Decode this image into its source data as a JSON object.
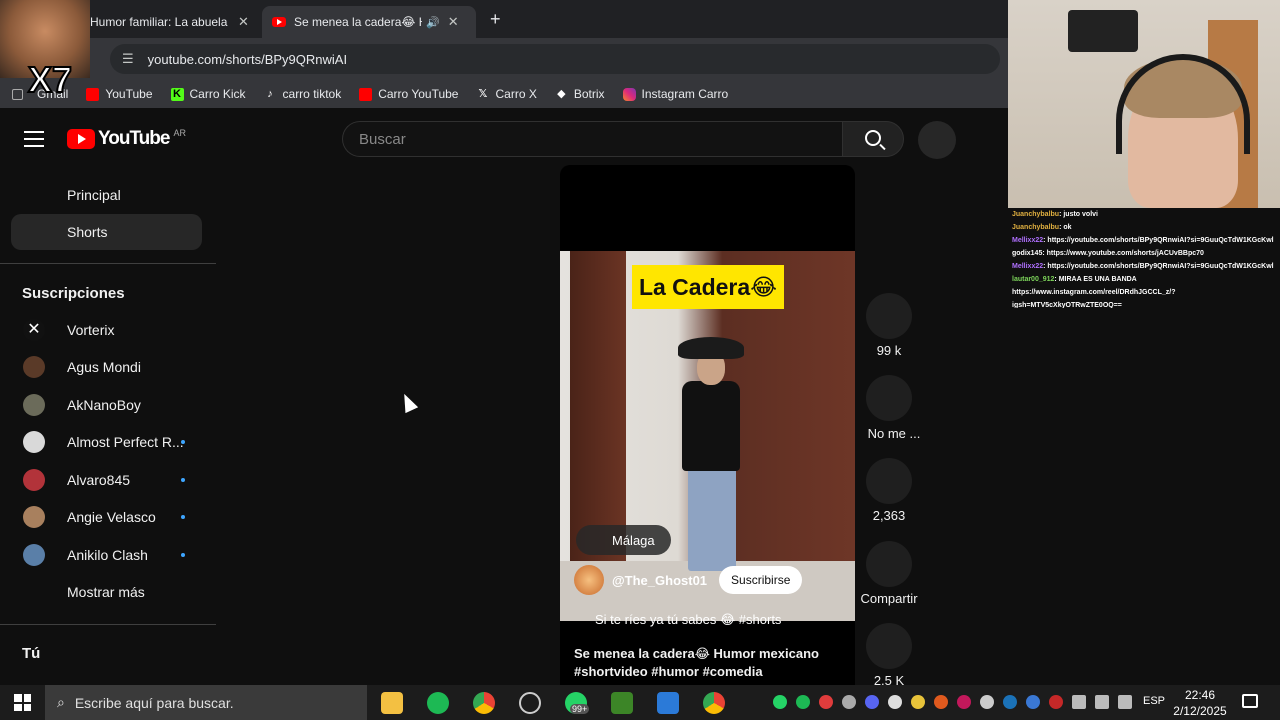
{
  "browser": {
    "tabs": [
      {
        "title": "Humor familiar: La abuela",
        "active": false
      },
      {
        "title": "Se menea la cadera😂 Hum",
        "active": true
      }
    ],
    "new_tab": "+",
    "close": "✕",
    "url": "youtube.com/shorts/BPy9QRnwiAI",
    "bookmarks": [
      {
        "label": "Gmail",
        "icon": "gmail-icon"
      },
      {
        "label": "YouTube",
        "icon": "youtube-icon"
      },
      {
        "label": "Carro Kick",
        "icon": "kick-icon"
      },
      {
        "label": "carro tiktok",
        "icon": "tiktok-icon"
      },
      {
        "label": "Carro YouTube",
        "icon": "youtube-icon"
      },
      {
        "label": "Carro X",
        "icon": "x-icon"
      },
      {
        "label": "Botrix",
        "icon": "botrix-icon"
      },
      {
        "label": "Instagram Carro",
        "icon": "instagram-icon"
      }
    ]
  },
  "youtube": {
    "logo": "YouTube",
    "region": "AR",
    "search_placeholder": "Buscar",
    "nav": [
      {
        "label": "Principal",
        "active": false
      },
      {
        "label": "Shorts",
        "active": true
      }
    ],
    "subs_heading": "Suscripciones",
    "subscriptions": [
      {
        "name": "Vorterix",
        "dot": false,
        "color": "#1a1a1a"
      },
      {
        "name": "Agus Mondi",
        "dot": false,
        "color": "#5a3a28"
      },
      {
        "name": "AkNanoBoy",
        "dot": false,
        "color": "#6b6b5a"
      },
      {
        "name": "Almost Perfect R...",
        "dot": true,
        "color": "#d9d9d9"
      },
      {
        "name": "Alvaro845",
        "dot": true,
        "color": "#b2333a"
      },
      {
        "name": "Angie Velasco",
        "dot": true,
        "color": "#a8805e"
      },
      {
        "name": "Anikilo Clash",
        "dot": true,
        "color": "#5a7fa8"
      }
    ],
    "show_more": "Mostrar más",
    "you_heading": "Tú",
    "short": {
      "overlay_text": "La Cadera😂",
      "location": "Málaga",
      "channel": "@The_Ghost01",
      "subscribe": "Suscribirse",
      "short_desc": "Si te ríes ya tú sabes 😂 #shorts",
      "title_line1": "Se menea la cadera😂 Humor mexicano",
      "title_line2": "#shortvideo #humor #comedia"
    },
    "actions": [
      {
        "label": "99 k",
        "icon": "like-icon"
      },
      {
        "label": "No me ...",
        "icon": "dislike-icon"
      },
      {
        "label": "2,363",
        "icon": "comment-icon"
      },
      {
        "label": "Compartir",
        "icon": "share-icon"
      },
      {
        "label": "2,5 K",
        "icon": "remix-icon"
      }
    ]
  },
  "stream": {
    "meme_label": "X7",
    "chat": [
      {
        "user": "Juanchybalbu",
        "msg": ": justo volvi",
        "color": "#e0b040"
      },
      {
        "user": "Juanchybalbu",
        "msg": ": ok",
        "color": "#e0b040"
      },
      {
        "user": "Mellixx22",
        "msg": ": https://youtube.com/shorts/BPy9QRnwiAI?si=9GuuQcTdW1KGcKwl",
        "color": "#b070ff"
      },
      {
        "user": "godix145",
        "msg": ": https://www.youtube.com/shorts/jACUvBBpc70",
        "color": "#ffffff"
      },
      {
        "user": "Mellixx22",
        "msg": ": https://youtube.com/shorts/BPy9QRnwiAI?si=9GuuQcTdW1KGcKwl",
        "color": "#b070ff"
      },
      {
        "user": "lautar00_912",
        "msg": ": MIRAA ES UNA BANDA",
        "color": "#7cd35a"
      },
      {
        "user": "",
        "msg": "https://www.instagram.com/reel/DRdhJGCCL_z/?",
        "color": "#ffffff"
      },
      {
        "user": "",
        "msg": "igsh=MTV5cXkyOTRwZTE0OQ==",
        "color": "#ffffff"
      }
    ]
  },
  "taskbar": {
    "search_placeholder": "Escribe aquí para buscar.",
    "badge": "99+",
    "language": "ESP",
    "time": "22:46",
    "date": "2/12/2025"
  }
}
